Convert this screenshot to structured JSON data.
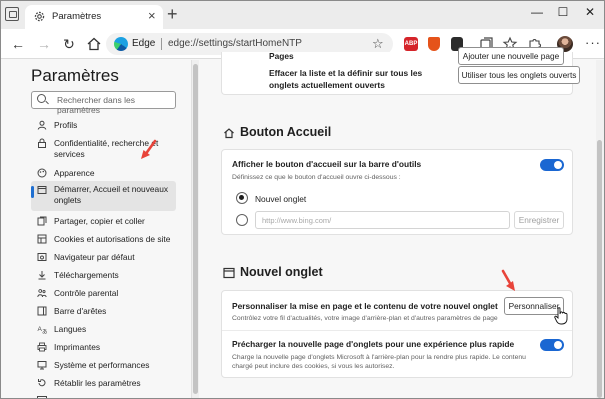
{
  "browser": {
    "tab_title": "Paramètres",
    "address_label": "Edge",
    "address_url": "edge://settings/startHomeNTP",
    "extensions": [
      {
        "name": "abp-icon",
        "label": "ABP",
        "color": "#d5242a"
      },
      {
        "name": "extension-orange-icon",
        "label": "",
        "color": "#e5531a"
      },
      {
        "name": "extension-dark-icon",
        "label": "",
        "color": "#2b2b2b"
      }
    ]
  },
  "sidebar": {
    "title": "Paramètres",
    "search_placeholder": "Rechercher dans les paramètres",
    "items": [
      {
        "label": "Profils",
        "icon": "profile-icon"
      },
      {
        "label": "Confidentialité, recherche et services",
        "icon": "lock-icon"
      },
      {
        "label": "Apparence",
        "icon": "appearance-icon"
      },
      {
        "label": "Démarrer, Accueil et nouveaux onglets",
        "icon": "home-tabs-icon",
        "active": true
      },
      {
        "label": "Partager, copier et coller",
        "icon": "share-icon"
      },
      {
        "label": "Cookies et autorisations de site",
        "icon": "cookies-icon"
      },
      {
        "label": "Navigateur par défaut",
        "icon": "browser-icon"
      },
      {
        "label": "Téléchargements",
        "icon": "download-icon"
      },
      {
        "label": "Contrôle parental",
        "icon": "family-icon"
      },
      {
        "label": "Barre d'arêtes",
        "icon": "edge-bar-icon"
      },
      {
        "label": "Langues",
        "icon": "language-icon"
      },
      {
        "label": "Imprimantes",
        "icon": "printer-icon"
      },
      {
        "label": "Système et performances",
        "icon": "system-icon"
      },
      {
        "label": "Rétablir les paramètres",
        "icon": "reset-icon"
      }
    ]
  },
  "main": {
    "top_card": {
      "partial_label": "Pages",
      "partial_button": "Ajouter une nouvelle page",
      "clear_label": "Effacer la liste et la définir sur tous les onglets actuellement ouverts",
      "clear_button": "Utiliser tous les onglets ouverts"
    },
    "home_section": {
      "title": "Bouton Accueil",
      "show_label": "Afficher le bouton d'accueil sur la barre d'outils",
      "show_sub": "Définissez ce que le bouton d'accueil ouvre ci-dessous :",
      "show_enabled": true,
      "radio_newtab_label": "Nouvel onglet",
      "url_placeholder": "http://www.bing.com/",
      "save_button": "Enregistrer"
    },
    "newtab_section": {
      "title": "Nouvel onglet",
      "customize_label": "Personnaliser la mise en page et le contenu de votre nouvel onglet",
      "customize_sub": "Contrôlez votre fil d'actualités, votre image d'arrière-plan et d'autres paramètres de page",
      "customize_button": "Personnaliser",
      "preload_label": "Précharger la nouvelle page d'onglets pour une expérience plus rapide",
      "preload_sub": "Charge la nouvelle page d'onglets Microsoft à l'arrière-plan pour la rendre plus rapide. Le contenu chargé peut inclure des cookies, si vous les autorisez.",
      "preload_enabled": true
    }
  },
  "colors": {
    "accent": "#1a67d2",
    "annotation_arrow": "#e8443a"
  }
}
